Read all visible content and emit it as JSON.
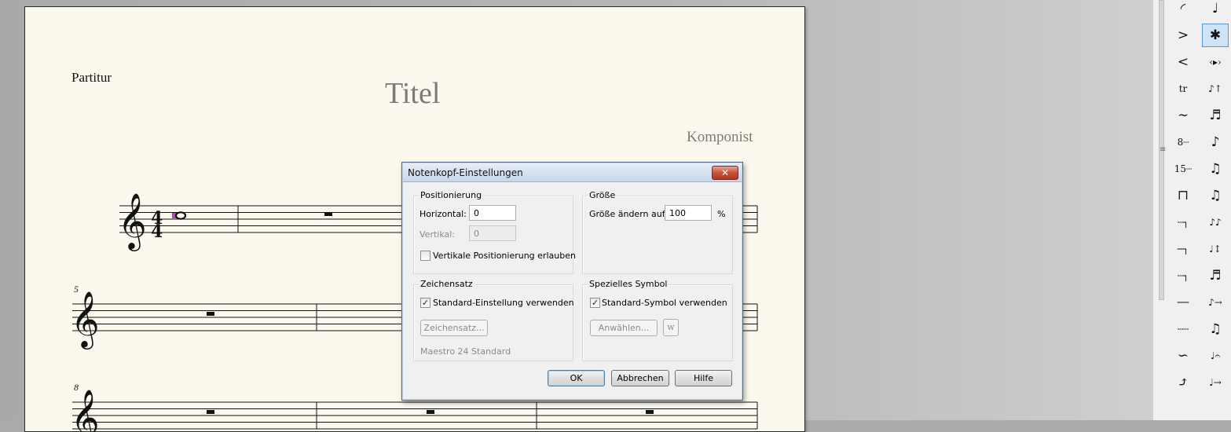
{
  "score": {
    "part_label": "Partitur",
    "title": "Titel",
    "composer": "Komponist",
    "time_signature": "4/4",
    "measure_numbers": [
      "5",
      "8"
    ]
  },
  "dialog": {
    "title": "Notenkopf-Einstellungen",
    "close_symbol": "✕",
    "positionierung": {
      "label": "Positionierung",
      "horizontal_label": "Horizontal:",
      "horizontal_value": "0",
      "vertical_label": "Vertikal:",
      "vertical_value": "0",
      "allow_vertical_label": "Vertikale Positionierung erlauben",
      "allow_vertical_checked": false
    },
    "groesse": {
      "label": "Größe",
      "change_label": "Größe ändern auf:",
      "value": "100",
      "unit": "%"
    },
    "zeichensatz": {
      "label": "Zeichensatz",
      "use_default_label": "Standard-Einstellung verwenden",
      "use_default_checked": true,
      "button_label": "Zeichensatz...",
      "font_name": "Maestro 24 Standard"
    },
    "spezielles_symbol": {
      "label": "Spezielles Symbol",
      "use_default_label": "Standard-Symbol verwenden",
      "use_default_checked": true,
      "select_button_label": "Anwählen...",
      "symbol_preview": "w"
    },
    "buttons": {
      "ok": "OK",
      "cancel": "Abbrechen",
      "help": "Hilfe"
    }
  },
  "palette": {
    "grip_symbol": "≡",
    "left_column": [
      {
        "glyph": "◜",
        "icon": "slur-arc-icon"
      },
      {
        "glyph": ">",
        "icon": "decrescendo-hairpin-icon"
      },
      {
        "glyph": "<",
        "icon": "crescendo-hairpin-icon"
      },
      {
        "glyph": "tr",
        "icon": "trill-icon"
      },
      {
        "glyph": "∼",
        "icon": "trill-extension-icon"
      },
      {
        "glyph": "8┈",
        "icon": "ottava-icon"
      },
      {
        "glyph": "15┈",
        "icon": "quindicesima-icon"
      },
      {
        "glyph": "⊓",
        "icon": "bracket-icon"
      },
      {
        "glyph": "┄┐",
        "icon": "dashed-bracket-icon"
      },
      {
        "glyph": "─┐",
        "icon": "line-hook-icon"
      },
      {
        "glyph": "┄┐",
        "icon": "dashed-hook-icon"
      },
      {
        "glyph": "──",
        "icon": "solid-line-icon"
      },
      {
        "glyph": "┄┄",
        "icon": "dashed-line-icon"
      },
      {
        "glyph": "∽",
        "icon": "glissando-icon"
      },
      {
        "glyph": "⤴",
        "icon": "bend-icon"
      }
    ],
    "right_column": [
      {
        "glyph": "♩",
        "icon": "note-position-icon"
      },
      {
        "glyph": "✱",
        "icon": "notehead-icon",
        "selected": true
      },
      {
        "glyph": "‹▸›",
        "icon": "accidental-move-icon"
      },
      {
        "glyph": "♪↑",
        "icon": "stem-direction-icon"
      },
      {
        "glyph": "♬",
        "icon": "beam-angle-icon"
      },
      {
        "glyph": "♪",
        "icon": "beam-extension-icon"
      },
      {
        "glyph": "♫",
        "icon": "secondary-beam-icon"
      },
      {
        "glyph": "♫",
        "icon": "beam-slope-icon"
      },
      {
        "glyph": "♪♪",
        "icon": "double-stem-icon"
      },
      {
        "glyph": "♩↕",
        "icon": "stem-length-icon"
      },
      {
        "glyph": "♬",
        "icon": "beam-break-icon"
      },
      {
        "glyph": "♪→",
        "icon": "flag-icon"
      },
      {
        "glyph": "♫",
        "icon": "beam-thickness-icon"
      },
      {
        "glyph": "♩𝄐",
        "icon": "dot-position-icon"
      },
      {
        "glyph": "♩→",
        "icon": "tie-direction-icon"
      }
    ]
  }
}
